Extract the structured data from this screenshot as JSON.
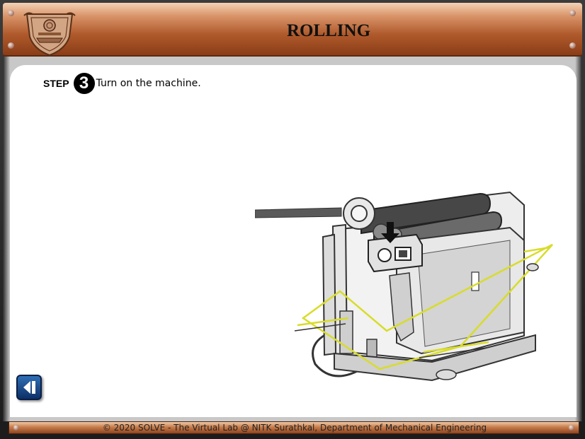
{
  "header": {
    "title": "ROLLING",
    "logo_icon": "nitk-crest-icon"
  },
  "step": {
    "label": "STEP",
    "number": "3",
    "instruction": "Turn on the machine."
  },
  "illustration": {
    "icon": "rolling-machine-illustration",
    "pointer_icon": "down-arrow-icon"
  },
  "navigation": {
    "back_icon": "back-arrow-icon"
  },
  "footer": {
    "copyright": "© 2020 SOLVE - The Virtual Lab @ NITK Surathkal, Department of Mechanical Engineering"
  },
  "colors": {
    "header_copper": "#b05a2c",
    "footer_copper": "#c77c4a",
    "highlight_yellow": "#d8dc2a",
    "back_button_blue": "#1f4f95"
  }
}
